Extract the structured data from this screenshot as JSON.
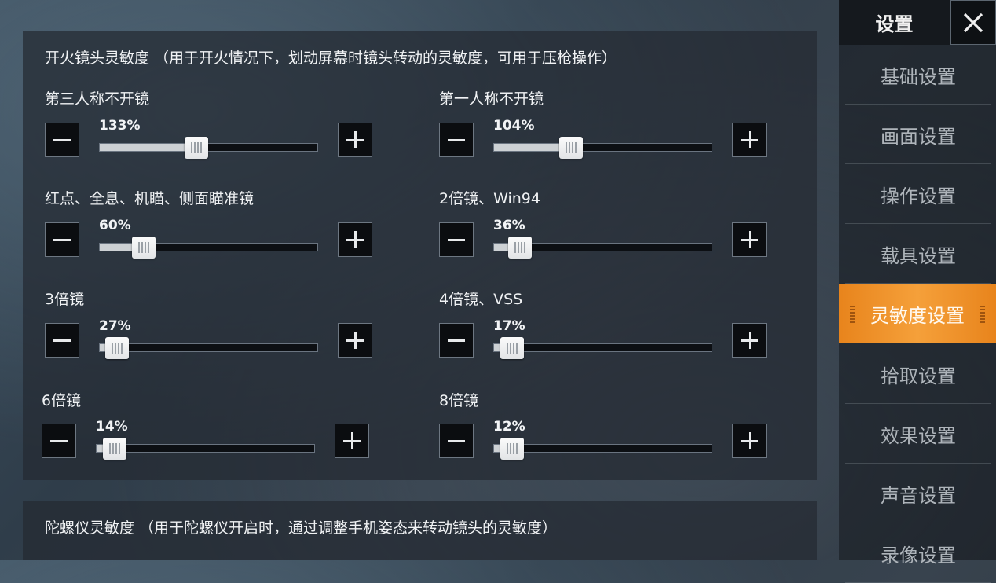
{
  "fire_section": {
    "title": "开火镜头灵敏度 （用于开火情况下，划动屏幕时镜头转动的灵敏度，可用于压枪操作）",
    "sliders": [
      {
        "label": "第三人称不开镜",
        "value_text": "133%",
        "fraction": 0.44
      },
      {
        "label": "第一人称不开镜",
        "value_text": "104%",
        "fraction": 0.35
      },
      {
        "label": "红点、全息、机瞄、侧面瞄准镜",
        "value_text": "60%",
        "fraction": 0.2
      },
      {
        "label": "2倍镜、Win94",
        "value_text": "36%",
        "fraction": 0.12
      },
      {
        "label": "3倍镜",
        "value_text": "27%",
        "fraction": 0.08
      },
      {
        "label": "4倍镜、VSS",
        "value_text": "17%",
        "fraction": 0.05
      },
      {
        "label": "6倍镜",
        "value_text": "14%",
        "fraction": 0.03
      },
      {
        "label": "8倍镜",
        "value_text": "12%",
        "fraction": 0.03
      }
    ]
  },
  "gyro_section": {
    "title": "陀螺仪灵敏度 （用于陀螺仪开启时，通过调整手机姿态来转动镜头的灵敏度）"
  },
  "sidebar": {
    "header": "设置",
    "close_icon": "close-icon",
    "items": [
      {
        "label": "基础设置"
      },
      {
        "label": "画面设置"
      },
      {
        "label": "操作设置"
      },
      {
        "label": "载具设置"
      },
      {
        "label": "灵敏度设置"
      },
      {
        "label": "拾取设置"
      },
      {
        "label": "效果设置"
      },
      {
        "label": "声音设置"
      },
      {
        "label": "录像设置"
      }
    ],
    "active_index": 4,
    "accent_color": "#f29a32"
  }
}
